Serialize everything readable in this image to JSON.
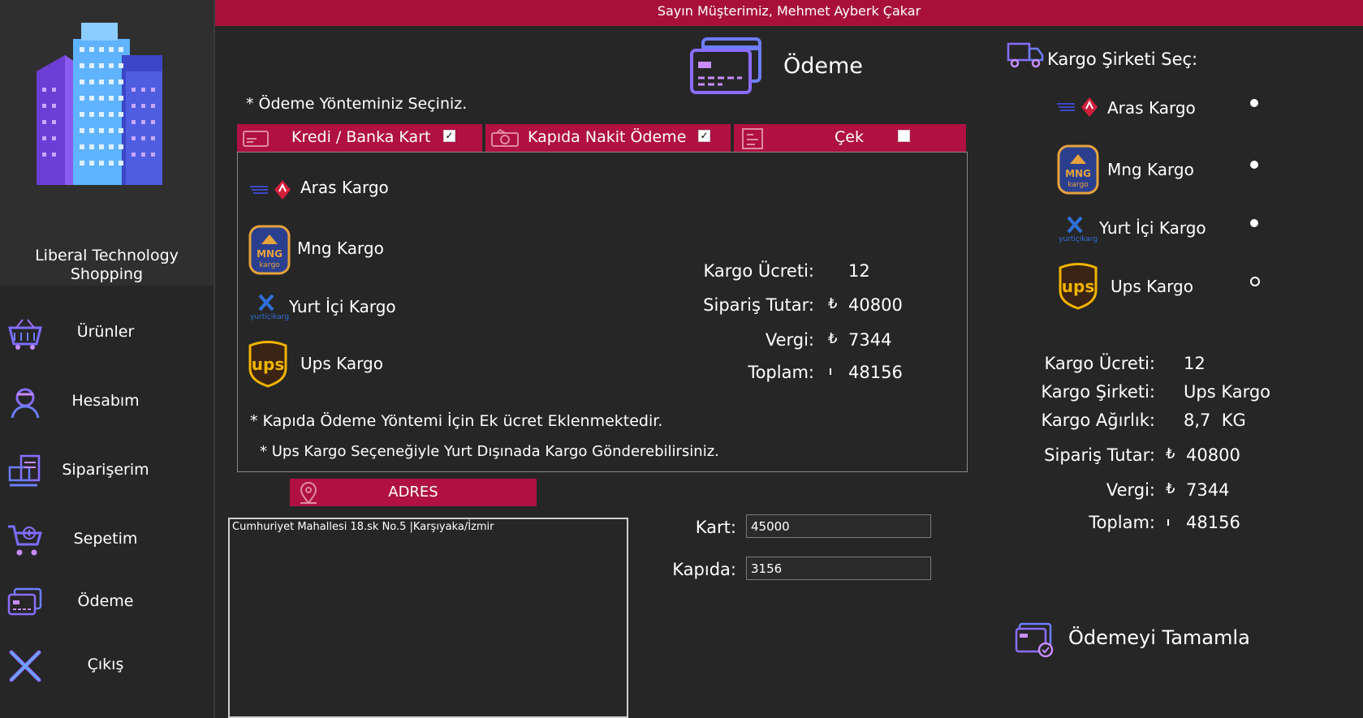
{
  "header": {
    "greeting": "Sayın Müşterimiz, Mehmet Ayberk Çakar"
  },
  "sidebar": {
    "app_name": "Liberal Technology Shopping",
    "items": [
      {
        "label": "Ürünler",
        "icon": "shopping-basket-icon"
      },
      {
        "label": "Hesabım",
        "icon": "user-icon"
      },
      {
        "label": "Siparişerim",
        "icon": "orders-icon"
      },
      {
        "label": "Sepetim",
        "icon": "cart-icon"
      },
      {
        "label": "Ödeme",
        "icon": "credit-card-icon"
      },
      {
        "label": "Çıkış",
        "icon": "close-icon"
      }
    ]
  },
  "payment": {
    "title": "Ödeme",
    "choose_method": "* Ödeme Yönteminiz Seçiniz.",
    "tabs": [
      {
        "label": "Kredi / Banka Kart",
        "checked": true
      },
      {
        "label": "Kapıda Nakit Ödeme",
        "checked": true
      },
      {
        "label": "Çek",
        "checked": false
      }
    ],
    "carriers": [
      "Aras Kargo",
      "Mng Kargo",
      "Yurt İçi Kargo",
      "Ups Kargo"
    ],
    "summary": {
      "shipping_fee_label": "Kargo Ücreti:",
      "shipping_fee": "12",
      "order_total_label": "Sipariş Tutar:",
      "order_total": "40800",
      "tax_label": "Vergi:",
      "tax": "7344",
      "total_label": "Toplam:",
      "total": "48156",
      "currency": "₺"
    },
    "note1": "* Kapıda Ödeme Yöntemi İçin Ek ücret Eklenmektedir.",
    "note2": "* Ups Kargo Seçeneğiyle Yurt Dışınada Kargo Gönderebilirsiniz."
  },
  "address": {
    "banner": "ADRES",
    "value": "Cumhuriyet Mahallesi 18.sk No.5  |Karşıyaka/İzmir"
  },
  "split": {
    "card_label": "Kart:",
    "card_value": "45000",
    "door_label": "Kapıda:",
    "door_value": "3156"
  },
  "cargo_select": {
    "title": "Kargo Şirketi Seç:",
    "options": [
      {
        "label": "Aras Kargo",
        "selected": false
      },
      {
        "label": "Mng Kargo",
        "selected": false
      },
      {
        "label": "Yurt İçi Kargo",
        "selected": false
      },
      {
        "label": "Ups Kargo",
        "selected": true
      }
    ]
  },
  "cargo_summary": {
    "fee_label": "Kargo Ücreti:",
    "fee": "12",
    "company_label": "Kargo Şirketi:",
    "company": "Ups Kargo",
    "weight_label": "Kargo Ağırlık:",
    "weight": "8,7  KG",
    "order_total_label": "Sipariş Tutar:",
    "order_total": "40800",
    "tax_label": "Vergi:",
    "tax": "7344",
    "total_label": "Toplam:",
    "total": "48156"
  },
  "complete_button": "Ödemeyi Tamamla",
  "colors": {
    "accent": "#b01042",
    "background": "#262626",
    "icon_purple": "#7b4dff"
  }
}
